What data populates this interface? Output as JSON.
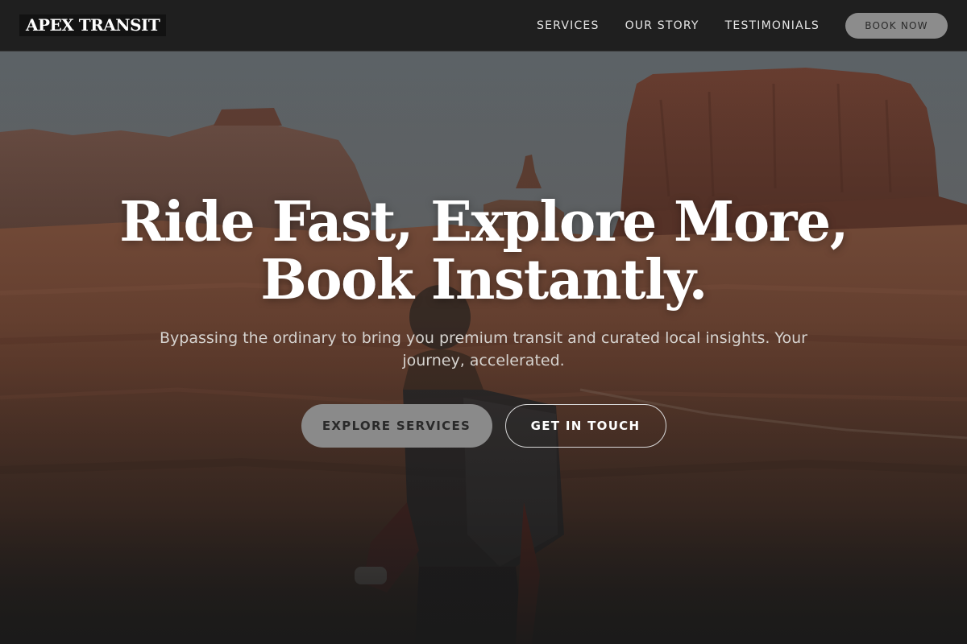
{
  "header": {
    "logo": "APEX TRANSIT",
    "nav": [
      {
        "label": "SERVICES"
      },
      {
        "label": "OUR STORY"
      },
      {
        "label": "TESTIMONIALS"
      }
    ],
    "cta_label": "BOOK NOW"
  },
  "hero": {
    "title_line1": "Ride Fast, Explore More,",
    "title_line2": "Book Instantly.",
    "subtitle": "Bypassing the ordinary to bring you premium transit and curated local insights. Your journey, accelerated.",
    "primary_button": "EXPLORE SERVICES",
    "secondary_button": "GET IN TOUCH",
    "background_image": "desert-mesa-traveler-photo"
  },
  "colors": {
    "header_bg": "#1f1f1f",
    "button_gray": "#8a8a8a",
    "text_white": "#ffffff",
    "desert_red": "#8a4a35"
  }
}
